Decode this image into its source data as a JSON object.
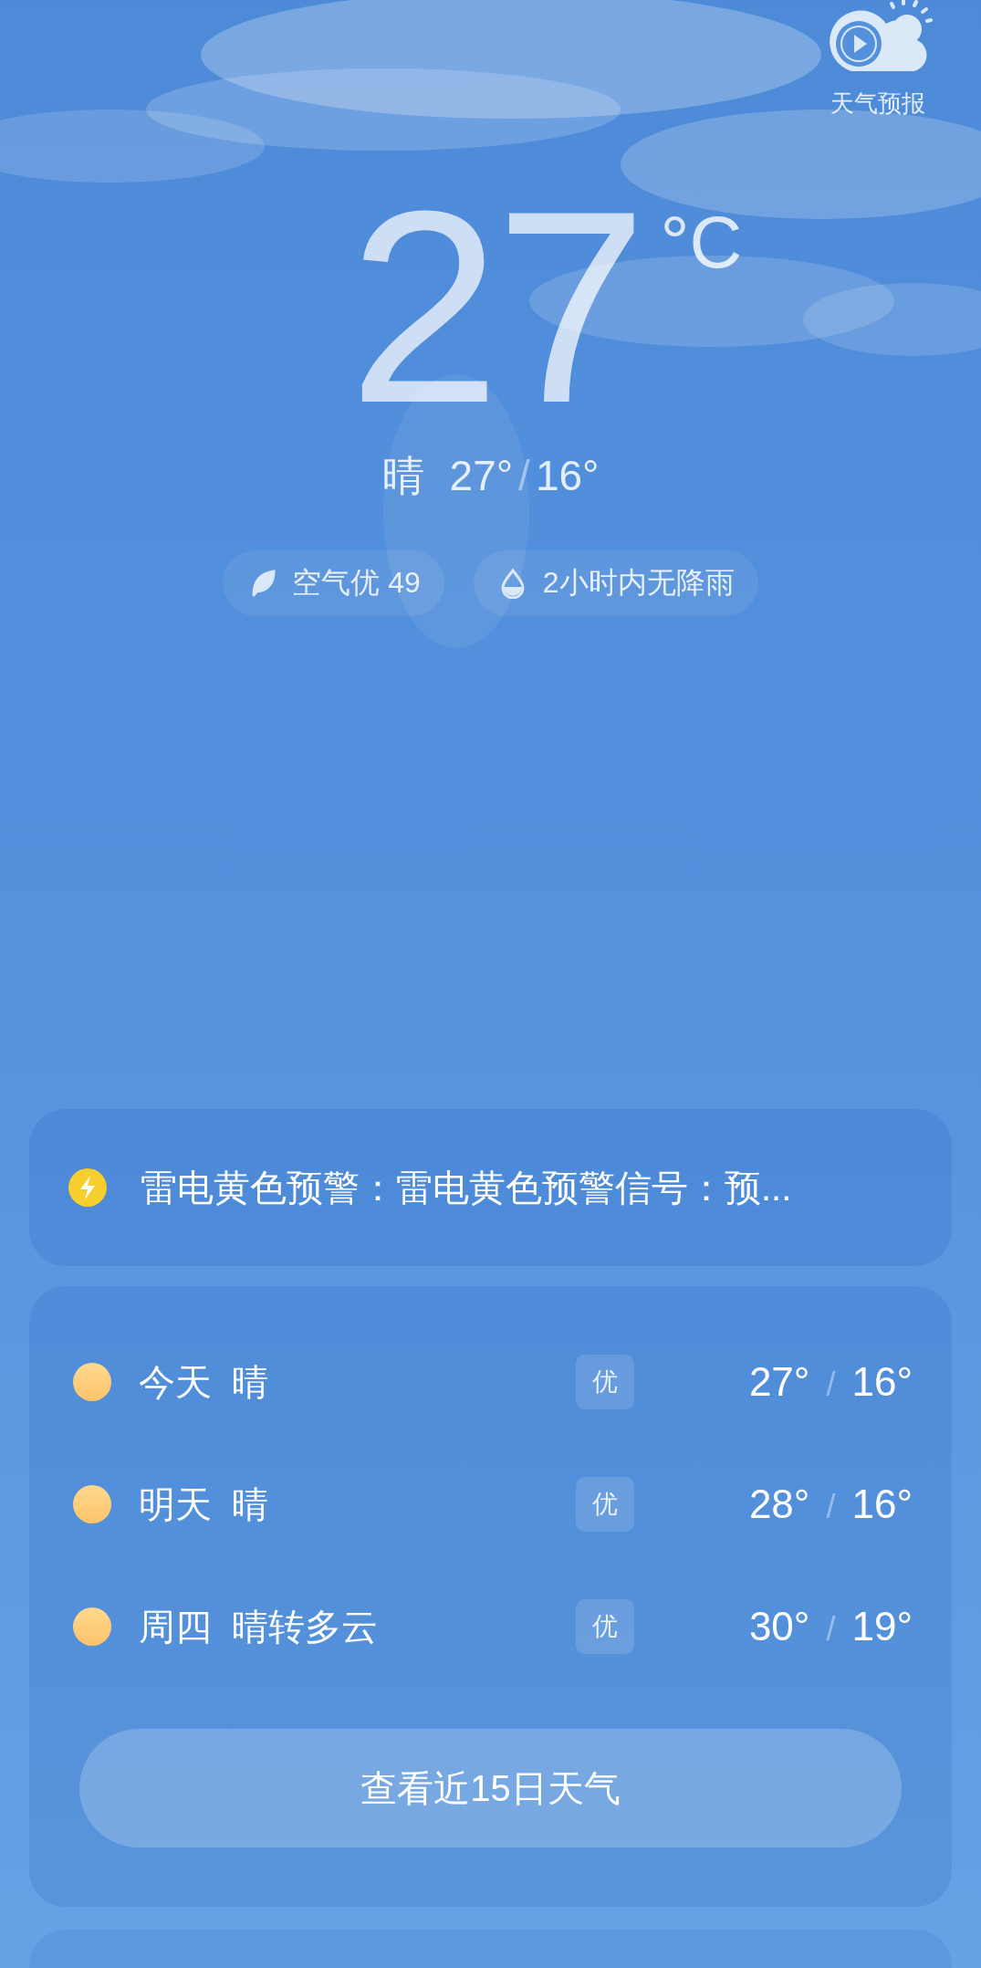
{
  "header": {
    "video_label": "天气预报"
  },
  "current": {
    "temperature": "27",
    "unit": "°C",
    "condition": "晴",
    "high": "27°",
    "separator": "/",
    "low": "16°"
  },
  "chips": [
    {
      "kind": "air",
      "text": "空气优 49"
    },
    {
      "kind": "rain",
      "text": "2小时内无降雨"
    }
  ],
  "alert": {
    "text": "雷电黄色预警：雷电黄色预警信号：预..."
  },
  "forecast": {
    "days": [
      {
        "day": "今天",
        "condition": "晴",
        "quality": "优",
        "high": "27°",
        "separator": "/",
        "low": "16°"
      },
      {
        "day": "明天",
        "condition": "晴",
        "quality": "优",
        "high": "28°",
        "separator": "/",
        "low": "16°"
      },
      {
        "day": "周四",
        "condition": "晴转多云",
        "quality": "优",
        "high": "30°",
        "separator": "/",
        "low": "19°"
      }
    ],
    "button": "查看近15日天气"
  }
}
